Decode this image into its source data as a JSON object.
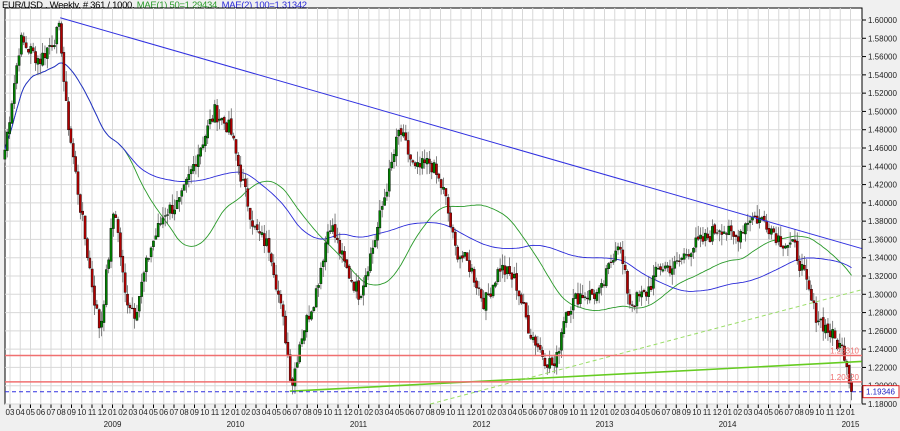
{
  "header": {
    "symbol": "EUR/USD , Weekly, # 361 / 1000, ",
    "ma1": "MAE(1) 50=1.29434, ",
    "ma2": "MAE(2) 100=1.31342"
  },
  "chart_data": {
    "type": "candlestick",
    "title": "EUR/USD , Weekly",
    "bars_shown": 361,
    "ylim": [
      1.18,
      1.61
    ],
    "y_ticks": [
      "1.18000",
      "1.20000",
      "1.22000",
      "1.24000",
      "1.26000",
      "1.28000",
      "1.30000",
      "1.32000",
      "1.34000",
      "1.36000",
      "1.38000",
      "1.40000",
      "1.42000",
      "1.44000",
      "1.46000",
      "1.48000",
      "1.50000",
      "1.52000",
      "1.54000",
      "1.56000",
      "1.58000",
      "1.60000"
    ],
    "x_month_labels": [
      "03",
      "04",
      "05",
      "06",
      "07",
      "08",
      "09",
      "10",
      "11",
      "12",
      "01",
      "02",
      "03",
      "04",
      "05",
      "06",
      "07",
      "08",
      "09",
      "10",
      "11",
      "12",
      "01",
      "02",
      "03",
      "04",
      "05",
      "06",
      "07",
      "08",
      "09",
      "10",
      "11",
      "12",
      "01",
      "02",
      "03",
      "04",
      "05",
      "06",
      "07",
      "08",
      "09",
      "10",
      "11",
      "12",
      "01",
      "02",
      "03",
      "04",
      "05",
      "06",
      "07",
      "08",
      "09",
      "10",
      "11",
      "12",
      "01",
      "02",
      "03",
      "04",
      "05",
      "06",
      "07",
      "08",
      "09",
      "10",
      "11",
      "12",
      "01",
      "02",
      "03",
      "04",
      "05",
      "06",
      "07",
      "08",
      "09",
      "10",
      "11",
      "12",
      "01"
    ],
    "x_year_labels": [
      {
        "label": "2009",
        "month_index": 10
      },
      {
        "label": "2010",
        "month_index": 22
      },
      {
        "label": "2011",
        "month_index": 34
      },
      {
        "label": "2012",
        "month_index": 46
      },
      {
        "label": "2013",
        "month_index": 58
      },
      {
        "label": "2014",
        "month_index": 70
      },
      {
        "label": "2015",
        "month_index": 82
      }
    ],
    "price_path_monthly": [
      [
        -0.5,
        1.458
      ],
      [
        1.0,
        1.578
      ],
      [
        2.9,
        1.556
      ],
      [
        4.9,
        1.59
      ],
      [
        5.4,
        1.51
      ],
      [
        6.8,
        1.4
      ],
      [
        8.3,
        1.29
      ],
      [
        8.8,
        1.26
      ],
      [
        10.2,
        1.4
      ],
      [
        11.2,
        1.3
      ],
      [
        12.2,
        1.28
      ],
      [
        13.7,
        1.35
      ],
      [
        15.1,
        1.39
      ],
      [
        16.6,
        1.4
      ],
      [
        18.5,
        1.46
      ],
      [
        20.0,
        1.5
      ],
      [
        21.5,
        1.48
      ],
      [
        22.4,
        1.435
      ],
      [
        23.9,
        1.37
      ],
      [
        25.4,
        1.35
      ],
      [
        26.8,
        1.26
      ],
      [
        27.5,
        1.2
      ],
      [
        28.3,
        1.25
      ],
      [
        29.8,
        1.3
      ],
      [
        31.2,
        1.38
      ],
      [
        32.7,
        1.33
      ],
      [
        34.1,
        1.3
      ],
      [
        35.6,
        1.36
      ],
      [
        36.6,
        1.41
      ],
      [
        38.0,
        1.48
      ],
      [
        39.5,
        1.435
      ],
      [
        41.0,
        1.445
      ],
      [
        42.4,
        1.41
      ],
      [
        43.4,
        1.35
      ],
      [
        44.9,
        1.33
      ],
      [
        46.3,
        1.29
      ],
      [
        47.8,
        1.33
      ],
      [
        49.3,
        1.315
      ],
      [
        50.7,
        1.26
      ],
      [
        52.2,
        1.23
      ],
      [
        53.2,
        1.22
      ],
      [
        54.1,
        1.28
      ],
      [
        55.6,
        1.3
      ],
      [
        57.6,
        1.3
      ],
      [
        59.3,
        1.36
      ],
      [
        60.5,
        1.29
      ],
      [
        62.0,
        1.3
      ],
      [
        63.4,
        1.33
      ],
      [
        64.9,
        1.33
      ],
      [
        66.3,
        1.35
      ],
      [
        67.8,
        1.36
      ],
      [
        69.3,
        1.375
      ],
      [
        70.7,
        1.36
      ],
      [
        72.2,
        1.385
      ],
      [
        73.7,
        1.38
      ],
      [
        75.1,
        1.36
      ],
      [
        76.6,
        1.35
      ],
      [
        77.6,
        1.315
      ],
      [
        78.5,
        1.28
      ],
      [
        79.5,
        1.265
      ],
      [
        80.5,
        1.25
      ],
      [
        81.5,
        1.235
      ],
      [
        82.1,
        1.19346
      ]
    ],
    "indicators": [
      {
        "name": "MAE(1) 50",
        "period": 50,
        "last": 1.29434,
        "color": "#2a9a2a"
      },
      {
        "name": "MAE(2) 100",
        "period": 100,
        "last": 1.31342,
        "color": "#2a2ad8"
      }
    ],
    "horizontal_levels": [
      {
        "label": "1.23310",
        "value": 1.2331,
        "color": "#f07070"
      },
      {
        "label": "1.20420",
        "value": 1.2042,
        "color": "#f07070"
      }
    ],
    "current_price": {
      "label": "1.19346",
      "value": 1.19346
    },
    "trendlines": [
      {
        "name": "resistance",
        "from": [
          4.9,
          1.6025
        ],
        "to": [
          83.1,
          1.35
        ],
        "color": "#3030e0"
      },
      {
        "name": "support",
        "from": [
          27.3,
          1.194
        ],
        "to": [
          83.1,
          1.2265
        ],
        "color": "#66cc22"
      },
      {
        "name": "dashed-support",
        "from": [
          41,
          1.18
        ],
        "to": [
          83.1,
          1.305
        ],
        "color": "#99dd66"
      }
    ],
    "colors": {
      "bull": "#008000",
      "bear": "#b00000",
      "grid": "#d8d8d8"
    }
  }
}
